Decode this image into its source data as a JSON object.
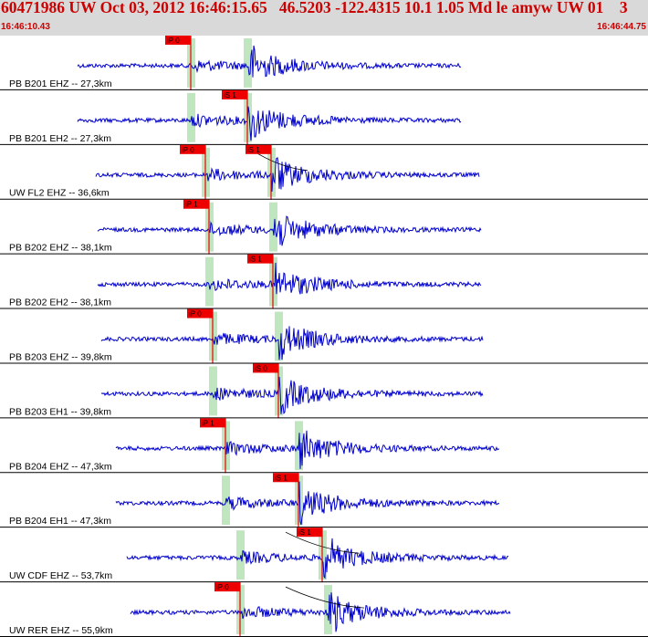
{
  "header": {
    "title": "60471986 UW Oct 03, 2012 16:46:15.65   46.5203 -122.4315 10.1 1.05 Md le amyw UW 01    3",
    "start_time": "16:46:10.43",
    "end_time": "16:46:44.75"
  },
  "colors": {
    "header_bg": "#d9d9d9",
    "header_text": "#cc0000",
    "trace": "#0000cc",
    "pick_marker": "#ee0000",
    "window": "#bfe6bf",
    "separator": "#000000"
  },
  "traces": [
    {
      "label": "PB B201 EHZ -- 27,3km",
      "picks": [
        {
          "text": "iP 0"
        }
      ],
      "p_sec": 6.2,
      "s_sec": 9.3,
      "start_sec": 0.0,
      "end_sec": 21.0,
      "ps_curve": false
    },
    {
      "label": "PB B201 EH2 -- 27,3km",
      "picks": [
        {
          "text": "iS 1"
        }
      ],
      "p_sec": 6.2,
      "s_sec": 9.3,
      "start_sec": 0.0,
      "end_sec": 21.0,
      "ps_curve": false
    },
    {
      "label": "UW FL2 EHZ -- 36,6km",
      "picks": [
        {
          "text": "iP 0"
        },
        {
          "text": "iS 1"
        }
      ],
      "p_sec": 7.0,
      "s_sec": 10.6,
      "start_sec": 1.0,
      "end_sec": 22.0,
      "ps_curve": true
    },
    {
      "label": "PB B202 EHZ -- 38,1km",
      "picks": [
        {
          "text": "iP 1"
        }
      ],
      "p_sec": 7.2,
      "s_sec": 10.7,
      "start_sec": 1.1,
      "end_sec": 22.1,
      "ps_curve": false
    },
    {
      "label": "PB B202 EH2 -- 38,1km",
      "picks": [
        {
          "text": "iS 1"
        }
      ],
      "p_sec": 7.2,
      "s_sec": 10.7,
      "start_sec": 1.1,
      "end_sec": 22.1,
      "ps_curve": false
    },
    {
      "label": "PB B203 EHZ -- 39,8km",
      "picks": [
        {
          "text": "iP 0"
        }
      ],
      "p_sec": 7.4,
      "s_sec": 11.0,
      "start_sec": 1.3,
      "end_sec": 22.2,
      "ps_curve": false
    },
    {
      "label": "PB B203 EH1 -- 39,8km",
      "picks": [
        {
          "text": "iS 0"
        }
      ],
      "p_sec": 7.4,
      "s_sec": 11.0,
      "start_sec": 1.3,
      "end_sec": 22.2,
      "ps_curve": false
    },
    {
      "label": "PB B204 EHZ -- 47,3km",
      "picks": [
        {
          "text": "iP 1"
        }
      ],
      "p_sec": 8.1,
      "s_sec": 12.1,
      "start_sec": 2.1,
      "end_sec": 23.1,
      "ps_curve": false
    },
    {
      "label": "PB B204 EH1 -- 47,3km",
      "picks": [
        {
          "text": "iS 1"
        }
      ],
      "p_sec": 8.1,
      "s_sec": 12.1,
      "start_sec": 2.1,
      "end_sec": 23.1,
      "ps_curve": false
    },
    {
      "label": "UW CDF EHZ -- 53,7km",
      "picks": [
        {
          "text": "iS 1"
        }
      ],
      "p_sec": 8.9,
      "s_sec": 13.4,
      "start_sec": 2.7,
      "end_sec": 23.6,
      "ps_curve": true
    },
    {
      "label": "UW RER EHZ -- 55,9km",
      "picks": [
        {
          "text": "iP 0"
        }
      ],
      "p_sec": 8.9,
      "s_sec": 13.7,
      "start_sec": 2.9,
      "end_sec": 23.7,
      "ps_curve": true
    }
  ]
}
